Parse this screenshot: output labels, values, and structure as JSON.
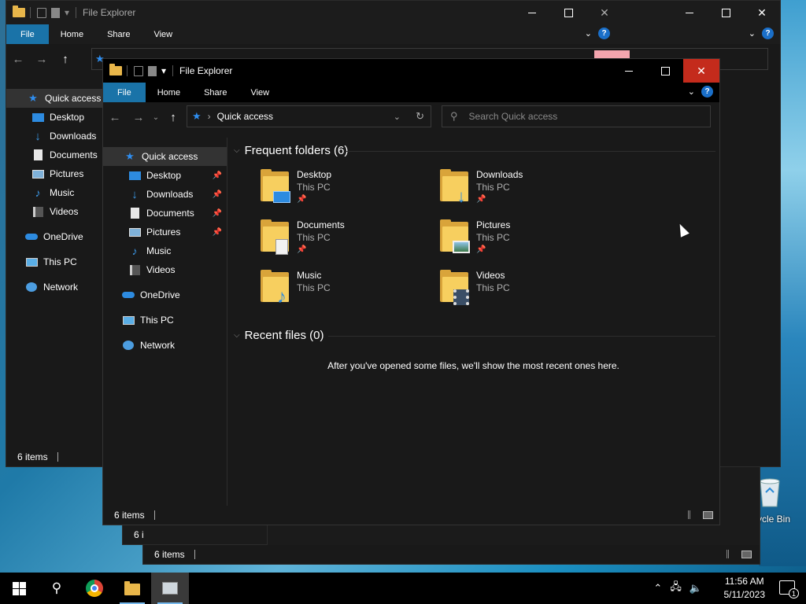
{
  "window_title": "File Explorer",
  "ribbon_tabs": [
    "File",
    "Home",
    "Share",
    "View"
  ],
  "help_label": "?",
  "address": {
    "location": "Quick access"
  },
  "search": {
    "placeholder": "Search Quick access"
  },
  "back_tree": [
    {
      "label": "Quick access",
      "icon": "star-icon"
    },
    {
      "label": "Desktop",
      "icon": "desktop-icon"
    },
    {
      "label": "Downloads",
      "icon": "download-icon"
    },
    {
      "label": "Documents",
      "icon": "document-icon"
    },
    {
      "label": "Pictures",
      "icon": "pictures-icon"
    },
    {
      "label": "Music",
      "icon": "music-icon"
    },
    {
      "label": "Videos",
      "icon": "videos-icon"
    },
    {
      "label": "OneDrive",
      "icon": "cloud-icon"
    },
    {
      "label": "This PC",
      "icon": "computer-icon"
    },
    {
      "label": "Network",
      "icon": "network-icon"
    }
  ],
  "tree": [
    {
      "label": "Quick access",
      "icon": "star-icon",
      "pinned": false
    },
    {
      "label": "Desktop",
      "icon": "desktop-icon",
      "pinned": true
    },
    {
      "label": "Downloads",
      "icon": "download-icon",
      "pinned": true
    },
    {
      "label": "Documents",
      "icon": "document-icon",
      "pinned": true
    },
    {
      "label": "Pictures",
      "icon": "pictures-icon",
      "pinned": true
    },
    {
      "label": "Music",
      "icon": "music-icon",
      "pinned": false
    },
    {
      "label": "Videos",
      "icon": "videos-icon",
      "pinned": false
    },
    {
      "label": "OneDrive",
      "icon": "cloud-icon",
      "pinned": false
    },
    {
      "label": "This PC",
      "icon": "computer-icon",
      "pinned": false
    },
    {
      "label": "Network",
      "icon": "network-icon",
      "pinned": false
    }
  ],
  "frequent": {
    "heading": "Frequent folders (6)",
    "folders": [
      {
        "name": "Desktop",
        "location": "This PC",
        "pinned": true
      },
      {
        "name": "Downloads",
        "location": "This PC",
        "pinned": true
      },
      {
        "name": "Documents",
        "location": "This PC",
        "pinned": true
      },
      {
        "name": "Pictures",
        "location": "This PC",
        "pinned": true
      },
      {
        "name": "Music",
        "location": "This PC",
        "pinned": false
      },
      {
        "name": "Videos",
        "location": "This PC",
        "pinned": false
      }
    ]
  },
  "recent": {
    "heading": "Recent files (0)",
    "empty_message": "After you've opened some files, we'll show the most recent ones here."
  },
  "status": {
    "count": "6 items",
    "count_truncated": "6 i"
  },
  "desktop": {
    "recycle_bin_label": "ycle Bin"
  },
  "clock": {
    "time": "11:56 AM",
    "date": "5/11/2023"
  },
  "notifications": {
    "count": "1"
  },
  "colors": {
    "accent": "#1a73a8",
    "close_hover": "#c42b1c",
    "window_bg": "#191919",
    "titlebar": "#000000"
  }
}
